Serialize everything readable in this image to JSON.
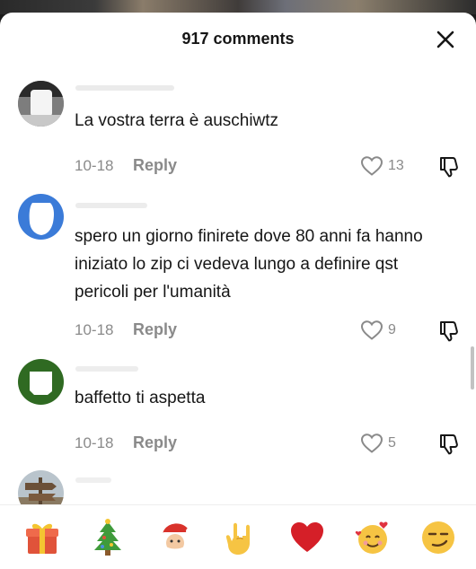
{
  "header": {
    "title": "917 comments",
    "close_icon": "close-icon"
  },
  "comments": [
    {
      "username": "",
      "text": "La vostra terra è auschiwtz",
      "date": "10-18",
      "reply_label": "Reply",
      "likes": "13"
    },
    {
      "username": "",
      "text": "spero un giorno finirete dove 80 anni fa hanno iniziato lo zip ci vedeva lungo a definire qst pericoli per l'umanità",
      "date": "10-18",
      "reply_label": "Reply",
      "likes": "9"
    },
    {
      "username": "",
      "text": "baffetto ti aspetta",
      "date": "10-18",
      "reply_label": "Reply",
      "likes": "5"
    }
  ],
  "emoji_bar": [
    {
      "name": "gift-emoji",
      "glyph": "🎁"
    },
    {
      "name": "christmas-tree-emoji",
      "glyph": "🎄"
    },
    {
      "name": "santa-emoji",
      "glyph": "🎅"
    },
    {
      "name": "love-you-gesture-emoji",
      "glyph": "🤟"
    },
    {
      "name": "red-heart-emoji",
      "glyph": "❤"
    },
    {
      "name": "smiling-face-with-hearts-emoji",
      "glyph": "🥰"
    },
    {
      "name": "smirking-face-emoji",
      "glyph": "😏"
    }
  ],
  "colors": {
    "text_primary": "#161616",
    "text_secondary": "#8a8a8a",
    "avatar_blue": "#3b7bd8",
    "avatar_green": "#2f6a22"
  }
}
